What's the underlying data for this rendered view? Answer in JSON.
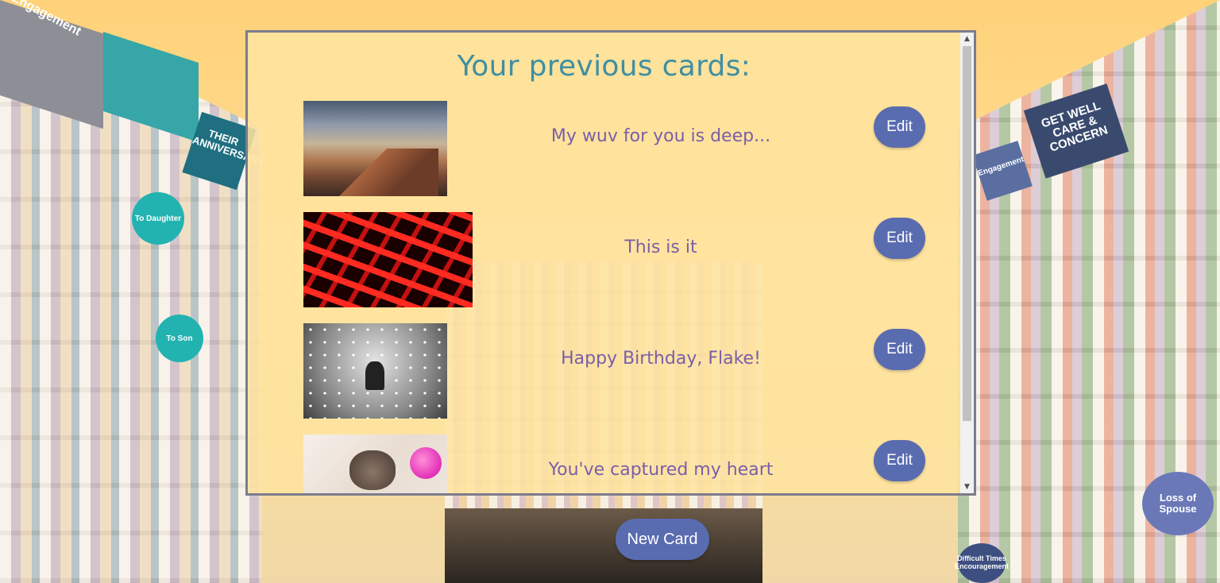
{
  "background": {
    "signs": {
      "engagement": "Engagement",
      "anniversary": "THEIR ANNIVERSARY",
      "to_daughter": "To Daughter",
      "to_son": "To Son",
      "get_well": "GET WELL CARE & CONCERN",
      "engagement_right": "Engagement",
      "loss_of_spouse": "Loss of Spouse",
      "difficult_times": "Difficult Times Encouragement"
    }
  },
  "panel": {
    "title": "Your previous cards:",
    "cards": [
      {
        "image": "grand-canyon-photo",
        "message": "My wuv for you is deep...",
        "edit_label": "Edit"
      },
      {
        "image": "red-keyboard-photo",
        "message": "This is it",
        "edit_label": "Edit"
      },
      {
        "image": "snow-running-photo",
        "message": "Happy Birthday, Flake!",
        "edit_label": "Edit"
      },
      {
        "image": "kitten-photo",
        "message": "You've captured my heart",
        "edit_label": "Edit"
      }
    ]
  },
  "new_card_label": "New Card",
  "colors": {
    "title": "#3f8fa3",
    "message": "#7b5ea8",
    "button": "#5a6cb0",
    "panel_bg": "#ffe4a0"
  }
}
